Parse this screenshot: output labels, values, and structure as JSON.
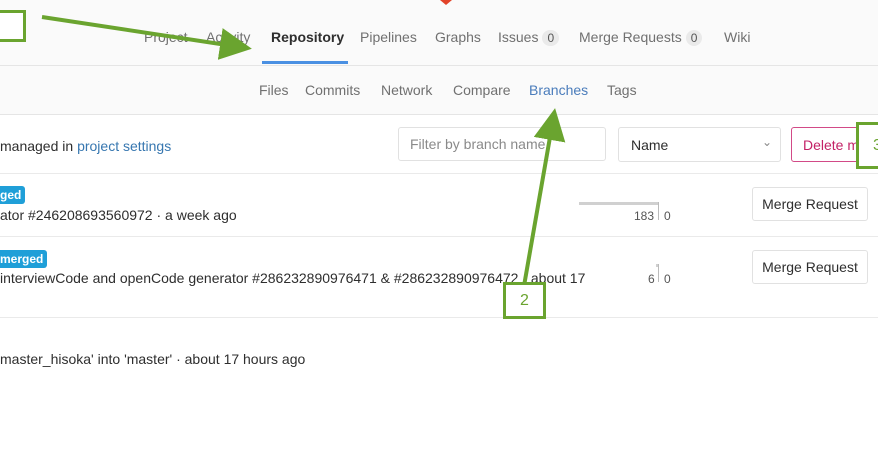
{
  "topnav": {
    "items": [
      {
        "label": "Project"
      },
      {
        "label": "Activity"
      },
      {
        "label": "Repository"
      },
      {
        "label": "Pipelines"
      },
      {
        "label": "Graphs"
      },
      {
        "label": "Issues",
        "count": "0"
      },
      {
        "label": "Merge Requests",
        "count": "0"
      },
      {
        "label": "Wiki"
      }
    ]
  },
  "subnav": {
    "items": [
      {
        "label": "Files"
      },
      {
        "label": "Commits"
      },
      {
        "label": "Network"
      },
      {
        "label": "Compare"
      },
      {
        "label": "Branches"
      },
      {
        "label": "Tags"
      }
    ]
  },
  "toolbar": {
    "managed_prefix": "managed in ",
    "managed_link": "project settings",
    "filter_placeholder": "Filter by branch name",
    "sort_value": "Name",
    "delete_label": "Delete m"
  },
  "branches": [
    {
      "badge": "ged",
      "commit": "ator #246208693560972 · a week ago",
      "behind": "183",
      "ahead": "0",
      "button": "Merge Request"
    },
    {
      "badge": "merged",
      "commit": "interviewCode and openCode generator #286232890976471 & #286232890976472 · about 17",
      "behind": "6",
      "ahead": "0",
      "button": "Merge Request"
    }
  ],
  "last_commit": "master_hisoka' into 'master' · about 17 hours ago",
  "annotations": {
    "callout_2": "2",
    "callout_3": "3"
  },
  "colors": {
    "accent": "#4a90e2",
    "annotation_green": "#6aa42f",
    "merged_label": "#1f9fd8",
    "delete_red": "#c32266"
  }
}
